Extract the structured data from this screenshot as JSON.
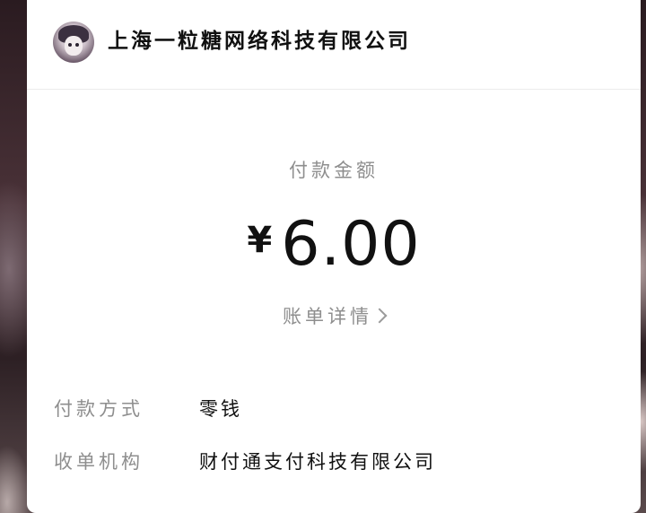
{
  "merchant": {
    "name": "上海一粒糖网络科技有限公司",
    "avatar_icon": "merchant-avatar"
  },
  "payment": {
    "amount_label": "付款金额",
    "currency_symbol": "¥",
    "amount": "6.00",
    "detail_link": "账单详情",
    "detail_icon": "chevron-right-icon"
  },
  "details": [
    {
      "label": "付款方式",
      "value": "零钱"
    },
    {
      "label": "收单机构",
      "value": "财付通支付科技有限公司"
    }
  ],
  "colors": {
    "primary_text": "#111111",
    "secondary_text": "#8e8e8e",
    "divider": "#ececec",
    "card_background": "#ffffff"
  }
}
